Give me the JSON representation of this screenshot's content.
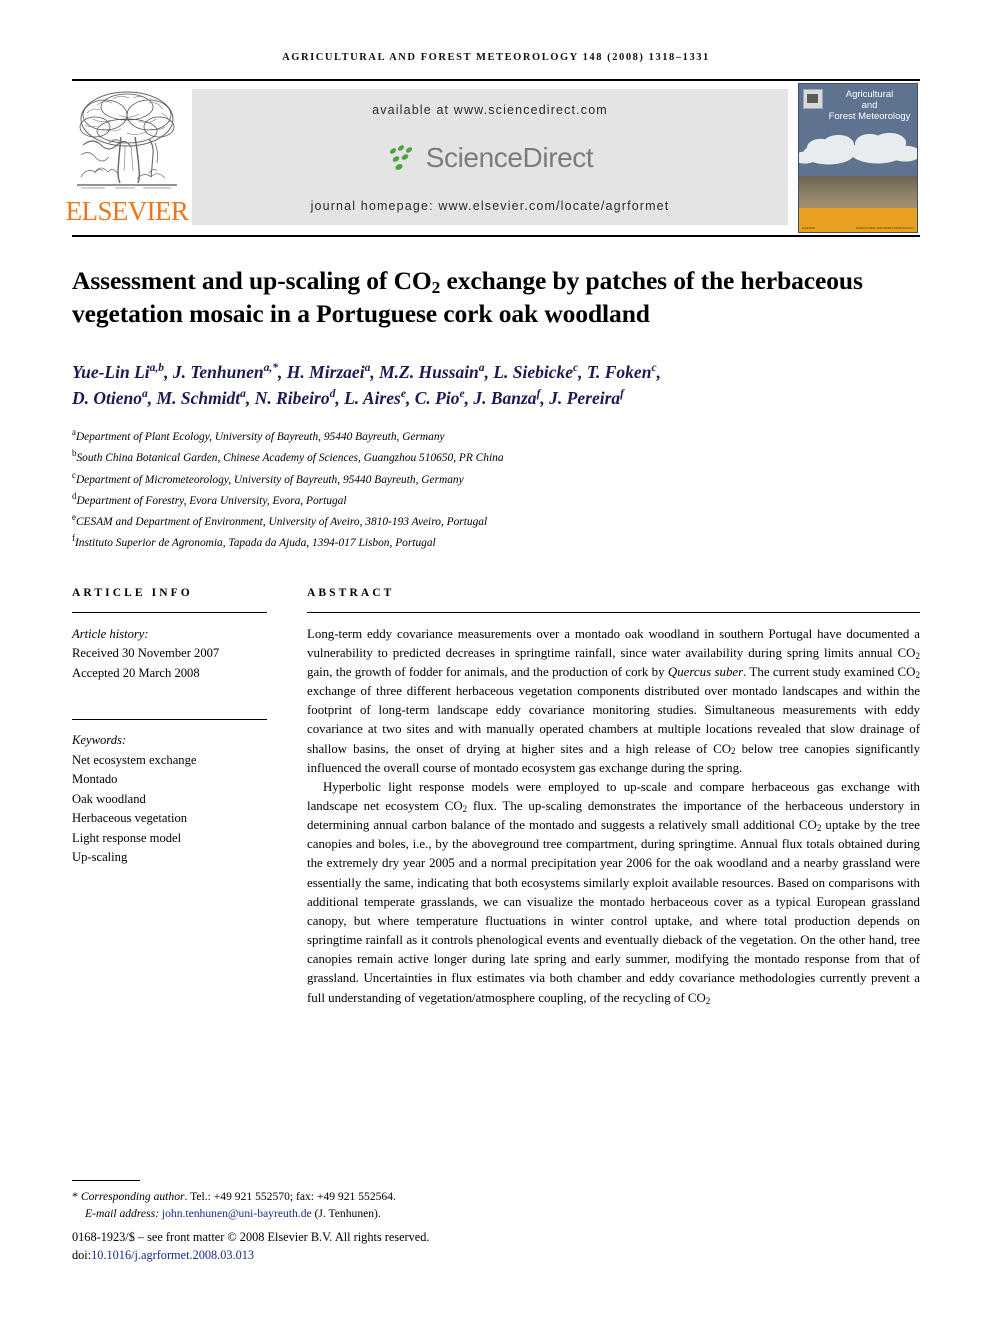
{
  "running_head": "AGRICULTURAL AND FOREST METEOROLOGY 148 (2008) 1318–1331",
  "masthead": {
    "publisher_name": "ELSEVIER",
    "publisher_logo_alt": "elsevier-tree-logo",
    "available_at": "available at www.sciencedirect.com",
    "sciencedirect_word": "ScienceDirect",
    "journal_homepage": "journal homepage: www.elsevier.com/locate/agrformet",
    "cover_title_line1": "Agricultural",
    "cover_title_line2": "and",
    "cover_title_line3": "Forest Meteorology",
    "cover_footer_left": "ELSEVIER",
    "cover_footer_right": "AGRICULTURAL AND FOREST METEOROLOGY"
  },
  "title": {
    "part1": "Assessment and up-scaling of CO",
    "sub1": "2",
    "part2": " exchange by patches of the herbaceous vegetation mosaic in a Portuguese cork oak woodland"
  },
  "authors_line1": "Yue-Lin Li a,b, J. Tenhunen a,*, H. Mirzaei a, M.Z. Hussain a, L. Siebicke c, T. Foken c,",
  "authors_line2": "D. Otieno a, M. Schmidt a, N. Ribeiro d, L. Aires e, C. Pio e, J. Banza f, J. Pereira f",
  "authors": [
    {
      "name": "Yue-Lin Li",
      "sup": "a,b",
      "sep": ", "
    },
    {
      "name": "J. Tenhunen",
      "sup": "a,*",
      "sep": ", "
    },
    {
      "name": "H. Mirzaei",
      "sup": "a",
      "sep": ", "
    },
    {
      "name": "M.Z. Hussain",
      "sup": "a",
      "sep": ", "
    },
    {
      "name": "L. Siebicke",
      "sup": "c",
      "sep": ", "
    },
    {
      "name": "T. Foken",
      "sup": "c",
      "sep": ", "
    },
    {
      "name": "D. Otieno",
      "sup": "a",
      "sep": ", "
    },
    {
      "name": "M. Schmidt",
      "sup": "a",
      "sep": ", "
    },
    {
      "name": "N. Ribeiro",
      "sup": "d",
      "sep": ", "
    },
    {
      "name": "L. Aires",
      "sup": "e",
      "sep": ", "
    },
    {
      "name": "C. Pio",
      "sup": "e",
      "sep": ", "
    },
    {
      "name": "J. Banza",
      "sup": "f",
      "sep": ", "
    },
    {
      "name": "J. Pereira",
      "sup": "f",
      "sep": ""
    }
  ],
  "affiliations": [
    {
      "mark": "a",
      "text": "Department of Plant Ecology, University of Bayreuth, 95440 Bayreuth, Germany"
    },
    {
      "mark": "b",
      "text": "South China Botanical Garden, Chinese Academy of Sciences, Guangzhou 510650, PR China"
    },
    {
      "mark": "c",
      "text": "Department of Micrometeorology, University of Bayreuth, 95440 Bayreuth, Germany"
    },
    {
      "mark": "d",
      "text": "Department of Forestry, Evora University, Evora, Portugal"
    },
    {
      "mark": "e",
      "text": "CESAM and Department of Environment, University of Aveiro, 3810-193 Aveiro, Portugal"
    },
    {
      "mark": "f",
      "text": "Instituto Superior de Agronomia, Tapada da Ajuda, 1394-017 Lisbon, Portugal"
    }
  ],
  "article_info": {
    "heading": "ARTICLE INFO",
    "history_label": "Article history:",
    "received": "Received 30 November 2007",
    "accepted": "Accepted 20 March 2008",
    "keywords_label": "Keywords:",
    "keywords": [
      "Net ecosystem exchange",
      "Montado",
      "Oak woodland",
      "Herbaceous vegetation",
      "Light response model",
      "Up-scaling"
    ]
  },
  "abstract": {
    "heading": "ABSTRACT",
    "paragraph1_a": "Long-term eddy covariance measurements over a montado oak woodland in southern Portugal have documented a vulnerability to predicted decreases in springtime rainfall, since water availability during spring limits annual CO",
    "paragraph1_b": " gain, the growth of fodder for animals, and the production of cork by ",
    "paragraph1_italic": "Quercus suber",
    "paragraph1_c": ". The current study examined CO",
    "paragraph1_d": " exchange of three different herbaceous vegetation components distributed over montado landscapes and within the footprint of long-term landscape eddy covariance monitoring studies. Simultaneous measurements with eddy covariance at two sites and with manually operated chambers at multiple locations revealed that slow drainage of shallow basins, the onset of drying at higher sites and a high release of CO",
    "paragraph1_e": " below tree canopies significantly influenced the overall course of montado ecosystem gas exchange during the spring.",
    "paragraph2_a": "Hyperbolic light response models were employed to up-scale and compare herbaceous gas exchange with landscape net ecosystem CO",
    "paragraph2_b": " flux. The up-scaling demonstrates the importance of the herbaceous understory in determining annual carbon balance of the montado and suggests a relatively small additional CO",
    "paragraph2_c": " uptake by the tree canopies and boles, i.e., by the aboveground tree compartment, during springtime. Annual flux totals obtained during the extremely dry year 2005 and a normal precipitation year 2006 for the oak woodland and a nearby grassland were essentially the same, indicating that both ecosystems similarly exploit available resources. Based on comparisons with additional temperate grasslands, we can visualize the montado herbaceous cover as a typical European grassland canopy, but where temperature fluctuations in winter control uptake, and where total production depends on springtime rainfall as it controls phenological events and eventually dieback of the vegetation. On the other hand, tree canopies remain active longer during late spring and early summer, modifying the montado response from that of grassland. Uncertainties in flux estimates via both chamber and eddy covariance methodologies currently prevent a full understanding of vegetation/atmosphere coupling, of the recycling of CO",
    "paragraph2_d": "",
    "subscript": "2"
  },
  "footer": {
    "corresponding_star": "*",
    "corresponding_label": "Corresponding author",
    "corresponding_contact": ". Tel.: +49 921 552570; fax: +49 921 552564.",
    "email_label": "E-mail address:",
    "email": "john.tenhunen@uni-bayreuth.de",
    "email_owner": "(J. Tenhunen).",
    "issn_line": "0168-1923/$ – see front matter © 2008 Elsevier B.V. All rights reserved.",
    "doi_label": "doi:",
    "doi_value": "10.1016/j.agrformet.2008.03.013"
  },
  "colors": {
    "elsevier_orange": "#E87722",
    "sciencedirect_green": "#4aa33c",
    "sciencedirect_gray": "#7c7c7c",
    "author_navy": "#1b1b52",
    "link_navy": "#1a2a8c",
    "banner_gray": "#e4e4e4",
    "cover_sky": "#5f7391",
    "cover_orange": "#e8a020"
  }
}
